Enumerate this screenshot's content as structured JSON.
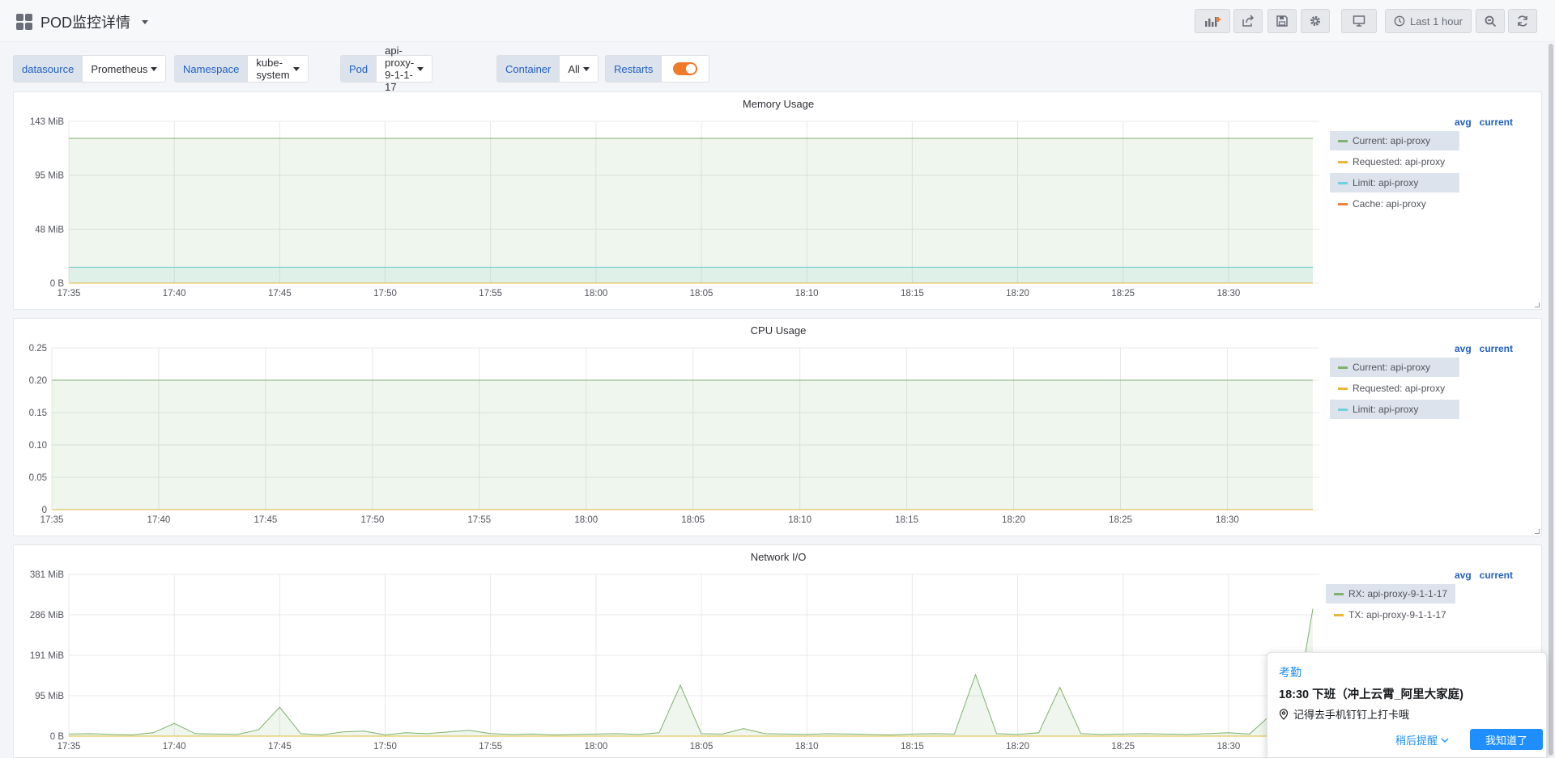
{
  "dashboard": {
    "title": "POD监控详情"
  },
  "toolbar": {
    "time_range": "Last 1 hour"
  },
  "variables": [
    {
      "label": "datasource",
      "value": "Prometheus"
    },
    {
      "label": "Namespace",
      "value": "kube-system"
    },
    {
      "label": "Pod",
      "value": "api-proxy-9-1-1-17"
    },
    {
      "label": "Container",
      "value": "All"
    },
    {
      "label": "Restarts",
      "value": true
    }
  ],
  "colors": {
    "green": "#7eb26d",
    "yellow": "#eab839",
    "blue": "#6ed0e0",
    "orange": "#ef843c",
    "accent": "#1f60c4"
  },
  "legend_headers": {
    "avg": "avg",
    "current": "current"
  },
  "panels": [
    {
      "title": "Memory Usage",
      "legend": [
        {
          "label": "Current: api-proxy",
          "color": "#7eb26d"
        },
        {
          "label": "Requested: api-proxy",
          "color": "#eab839"
        },
        {
          "label": "Limit: api-proxy",
          "color": "#6ed0e0"
        },
        {
          "label": "Cache: api-proxy",
          "color": "#ef843c"
        }
      ]
    },
    {
      "title": "CPU Usage",
      "legend": [
        {
          "label": "Current: api-proxy",
          "color": "#7eb26d"
        },
        {
          "label": "Requested: api-proxy",
          "color": "#eab839"
        },
        {
          "label": "Limit: api-proxy",
          "color": "#6ed0e0"
        }
      ]
    },
    {
      "title": "Network I/O",
      "legend": [
        {
          "label": "RX: api-proxy-9-1-1-17",
          "color": "#7eb26d"
        },
        {
          "label": "TX: api-proxy-9-1-1-17",
          "color": "#eab839"
        }
      ]
    }
  ],
  "chart_data": [
    {
      "type": "area",
      "title": "Memory Usage",
      "x_ticks": [
        "17:35",
        "17:40",
        "17:45",
        "17:50",
        "17:55",
        "18:00",
        "18:05",
        "18:10",
        "18:15",
        "18:20",
        "18:25",
        "18:30"
      ],
      "y_ticks": [
        "143 MiB",
        "95 MiB",
        "48 MiB",
        "0 B"
      ],
      "ylim": [
        0,
        143
      ],
      "unit": "MiB",
      "grid": true,
      "legend_position": "right",
      "series": [
        {
          "name": "Current: api-proxy",
          "x": [
            "17:35",
            "18:35"
          ],
          "values": [
            128,
            128
          ]
        },
        {
          "name": "Requested: api-proxy",
          "x": [
            "17:35",
            "18:35"
          ],
          "values": [
            0,
            0
          ]
        },
        {
          "name": "Limit: api-proxy",
          "x": [
            "17:35",
            "18:35"
          ],
          "values": [
            14,
            14
          ]
        },
        {
          "name": "Cache: api-proxy",
          "x": [
            "17:35",
            "18:35"
          ],
          "values": [
            0,
            0
          ]
        }
      ]
    },
    {
      "type": "area",
      "title": "CPU Usage",
      "x_ticks": [
        "17:35",
        "17:40",
        "17:45",
        "17:50",
        "17:55",
        "18:00",
        "18:05",
        "18:10",
        "18:15",
        "18:20",
        "18:25",
        "18:30"
      ],
      "y_ticks": [
        "0.25",
        "0.20",
        "0.15",
        "0.10",
        "0.05",
        "0"
      ],
      "ylim": [
        0,
        0.25
      ],
      "grid": true,
      "legend_position": "right",
      "series": [
        {
          "name": "Current: api-proxy",
          "x": [
            "17:35",
            "18:35"
          ],
          "values": [
            0.2,
            0.2
          ]
        },
        {
          "name": "Requested: api-proxy",
          "x": [
            "17:35",
            "18:35"
          ],
          "values": [
            0,
            0
          ]
        },
        {
          "name": "Limit: api-proxy",
          "x": [
            "17:35",
            "18:35"
          ],
          "values": [
            0,
            0
          ]
        }
      ]
    },
    {
      "type": "area",
      "title": "Network I/O",
      "x_ticks": [
        "17:35",
        "17:40",
        "17:45",
        "17:50",
        "17:55",
        "18:00",
        "18:05",
        "18:10",
        "18:15",
        "18:20",
        "18:25",
        "18:30"
      ],
      "y_ticks": [
        "381 MiB",
        "286 MiB",
        "191 MiB",
        "95 MiB",
        "0 B"
      ],
      "ylim": [
        0,
        381
      ],
      "unit": "MiB",
      "grid": true,
      "legend_position": "right",
      "series": [
        {
          "name": "RX: api-proxy-9-1-1-17",
          "x": [
            "17:35",
            "17:36",
            "17:37",
            "17:38",
            "17:39",
            "17:40",
            "17:41",
            "17:42",
            "17:43",
            "17:44",
            "17:45",
            "17:46",
            "17:47",
            "17:48",
            "17:49",
            "17:50",
            "17:51",
            "17:52",
            "17:53",
            "17:54",
            "17:55",
            "17:56",
            "17:57",
            "17:58",
            "17:59",
            "18:00",
            "18:01",
            "18:02",
            "18:03",
            "18:04",
            "18:05",
            "18:06",
            "18:07",
            "18:08",
            "18:09",
            "18:10",
            "18:11",
            "18:12",
            "18:13",
            "18:14",
            "18:15",
            "18:16",
            "18:17",
            "18:18",
            "18:19",
            "18:20",
            "18:21",
            "18:22",
            "18:23",
            "18:24",
            "18:25",
            "18:26",
            "18:27",
            "18:28",
            "18:29",
            "18:30",
            "18:31",
            "18:32",
            "18:33",
            "18:34"
          ],
          "values": [
            5,
            6,
            4,
            3,
            8,
            30,
            6,
            5,
            4,
            15,
            68,
            6,
            3,
            10,
            12,
            3,
            8,
            6,
            10,
            14,
            6,
            4,
            5,
            3,
            4,
            5,
            6,
            4,
            8,
            120,
            6,
            5,
            18,
            6,
            5,
            4,
            6,
            5,
            4,
            3,
            5,
            6,
            5,
            145,
            6,
            4,
            8,
            115,
            6,
            4,
            5,
            6,
            5,
            4,
            6,
            8,
            5,
            50,
            6,
            300
          ]
        },
        {
          "name": "TX: api-proxy-9-1-1-17",
          "x": [
            "17:35",
            "18:34"
          ],
          "values": [
            0,
            0
          ]
        }
      ]
    }
  ],
  "notification": {
    "category": "考勤",
    "title": "18:30 下班（冲上云霄_阿里大家庭)",
    "subtitle": "记得去手机钉钉上打卡哦",
    "later": "稍后提醒",
    "ok": "我知道了"
  }
}
